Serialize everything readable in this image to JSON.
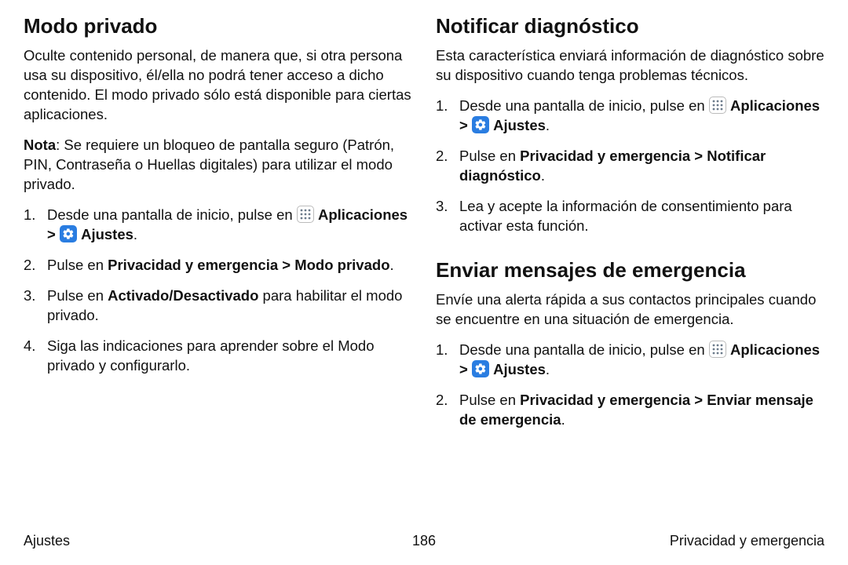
{
  "left": {
    "heading": "Modo privado",
    "intro": "Oculte contenido personal, de manera que, si otra persona usa su dispositivo, él/ella no podrá tener acceso a dicho contenido. El modo privado sólo está disponible para ciertas aplicaciones.",
    "note_label": "Nota",
    "note_body": ": Se requiere un bloqueo de pantalla seguro (Patrón, PIN, Contraseña o Huellas digitales) para utilizar el modo privado.",
    "step1_a": "Desde una pantalla de inicio, pulse en ",
    "apps_label": "Aplicaciones",
    "caret": " > ",
    "settings_label": "Ajustes",
    "period": ".",
    "step2_a": "Pulse en ",
    "step2_b": "Privacidad y emergencia",
    "step2_c": "Modo privado",
    "step3_a": "Pulse en ",
    "step3_b": "Activado/Desactivado",
    "step3_c": " para habilitar el modo privado.",
    "step4": "Siga las indicaciones para aprender sobre el Modo privado y configurarlo."
  },
  "right_a": {
    "heading": "Notificar diagnóstico",
    "intro": "Esta característica enviará información de diagnóstico sobre su dispositivo cuando tenga problemas técnicos.",
    "step1_a": "Desde una pantalla de inicio, pulse en ",
    "step2_a": "Pulse en ",
    "step2_b": "Privacidad y emergencia",
    "step2_c": "Notificar diagnóstico",
    "step3": "Lea y acepte la información de consentimiento para activar esta función."
  },
  "right_b": {
    "heading": "Enviar mensajes de emergencia",
    "intro": "Envíe una alerta rápida a sus contactos principales cuando se encuentre en una situación de emergencia.",
    "step1_a": "Desde una pantalla de inicio, pulse en ",
    "step2_a": "Pulse en ",
    "step2_b": "Privacidad y emergencia",
    "step2_c": "Enviar mensaje de emergencia"
  },
  "footer": {
    "left": "Ajustes",
    "center": "186",
    "right": "Privacidad y emergencia"
  }
}
